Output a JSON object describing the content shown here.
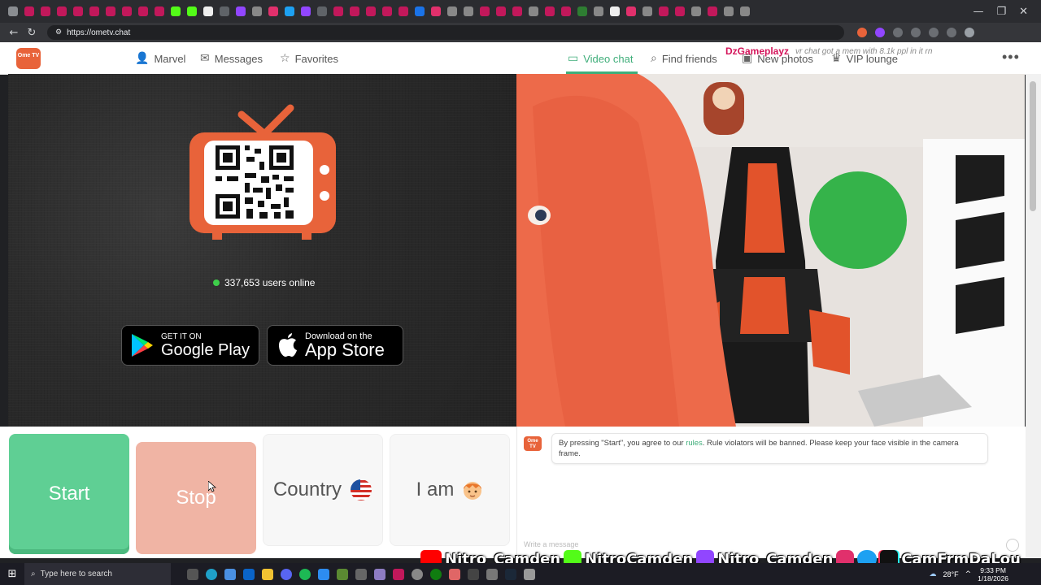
{
  "browser": {
    "url": "https://ometv.chat",
    "window_controls": [
      "—",
      "❐",
      "✕"
    ]
  },
  "site": {
    "logo_text": "Ome TV",
    "nav": {
      "marvel": "Marvel",
      "messages": "Messages",
      "favorites": "Favorites",
      "video_chat": "Video chat",
      "find_friends": "Find friends",
      "new_photos": "New photos",
      "vip_lounge": "VIP lounge"
    },
    "overlay_name": "DzGameplayz",
    "overlay_msg": "vr chat got a mem with 8.1k ppl in it rn",
    "accent": "#3fae7a"
  },
  "left_panel": {
    "users_online": "337,653 users online",
    "google_play": {
      "small": "GET IT ON",
      "big": "Google Play"
    },
    "app_store": {
      "small": "Download on the",
      "big": "App Store"
    }
  },
  "controls": {
    "start": "Start",
    "stop": "Stop",
    "country": "Country",
    "iam": "I am"
  },
  "chat": {
    "notice_pre": "By pressing \"Start\", you agree to our ",
    "notice_link": "rules",
    "notice_post": ". Rule violators will be banned. Please keep your face visible in the camera frame.",
    "input_placeholder": "Write a message"
  },
  "stream_overlay": {
    "youtube": "Nitro_Camden",
    "kick": "NitroCamden",
    "twitch": "Nitro_Camden",
    "socials": "CamFrmDaLou"
  },
  "taskbar": {
    "search_placeholder": "Type here to search",
    "temperature": "28°F",
    "time": "9:33 PM",
    "date": "1/18/2026"
  }
}
